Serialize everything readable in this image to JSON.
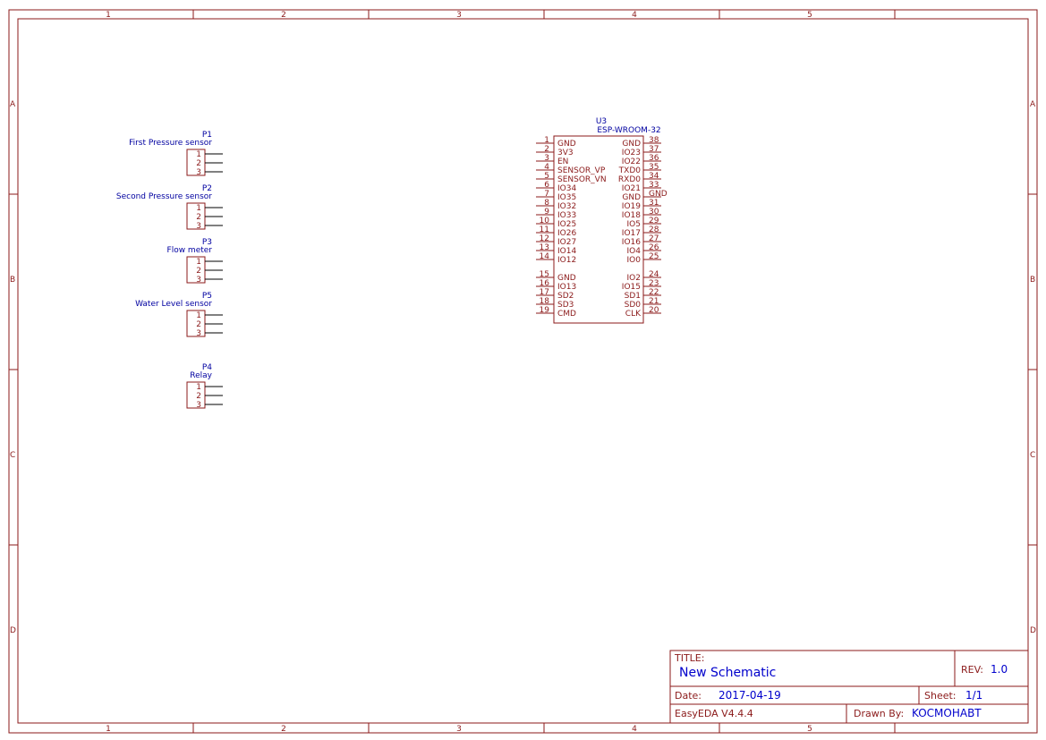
{
  "frame": {
    "columns": [
      "1",
      "2",
      "3",
      "4",
      "5"
    ],
    "rows": [
      "A",
      "B",
      "C",
      "D"
    ]
  },
  "connectors": [
    {
      "designator": "P1",
      "name": "First Pressure sensor",
      "pins": [
        "1",
        "2",
        "3"
      ]
    },
    {
      "designator": "P2",
      "name": "Second Pressure sensor",
      "pins": [
        "1",
        "2",
        "3"
      ]
    },
    {
      "designator": "P3",
      "name": "Flow meter",
      "pins": [
        "1",
        "2",
        "3"
      ]
    },
    {
      "designator": "P5",
      "name": "Water Level sensor",
      "pins": [
        "1",
        "2",
        "3"
      ]
    },
    {
      "designator": "P4",
      "name": "Relay",
      "pins": [
        "1",
        "2",
        "3"
      ]
    }
  ],
  "module": {
    "designator": "U3",
    "name": "ESP-WROOM-32",
    "left_pins": [
      {
        "num": "1",
        "label": "GND"
      },
      {
        "num": "2",
        "label": "3V3"
      },
      {
        "num": "3",
        "label": "EN"
      },
      {
        "num": "4",
        "label": "SENSOR_VP"
      },
      {
        "num": "5",
        "label": "SENSOR_VN"
      },
      {
        "num": "6",
        "label": "IO34"
      },
      {
        "num": "7",
        "label": "IO35"
      },
      {
        "num": "8",
        "label": "IO32"
      },
      {
        "num": "9",
        "label": "IO33"
      },
      {
        "num": "10",
        "label": "IO25"
      },
      {
        "num": "11",
        "label": "IO26"
      },
      {
        "num": "12",
        "label": "IO27"
      },
      {
        "num": "13",
        "label": "IO14"
      },
      {
        "num": "14",
        "label": "IO12"
      },
      {
        "num": "15",
        "label": "GND"
      },
      {
        "num": "16",
        "label": "IO13"
      },
      {
        "num": "17",
        "label": "SD2"
      },
      {
        "num": "18",
        "label": "SD3"
      },
      {
        "num": "19",
        "label": "CMD"
      }
    ],
    "right_pins": [
      {
        "num": "38",
        "label": "GND"
      },
      {
        "num": "37",
        "label": "IO23"
      },
      {
        "num": "36",
        "label": "IO22"
      },
      {
        "num": "35",
        "label": "TXD0"
      },
      {
        "num": "34",
        "label": "RXD0"
      },
      {
        "num": "33",
        "label": "IO21"
      },
      {
        "num": "GND",
        "label": ""
      },
      {
        "num": "31",
        "label": "IO19"
      },
      {
        "num": "30",
        "label": "IO18"
      },
      {
        "num": "29",
        "label": "IO5"
      },
      {
        "num": "28",
        "label": "IO17"
      },
      {
        "num": "27",
        "label": "IO16"
      },
      {
        "num": "26",
        "label": "IO4"
      },
      {
        "num": "25",
        "label": "IO0"
      },
      {
        "num": "24",
        "label": "IO2"
      },
      {
        "num": "23",
        "label": "IO15"
      },
      {
        "num": "22",
        "label": "SD1"
      },
      {
        "num": "21",
        "label": "SD0"
      },
      {
        "num": "20",
        "label": "CLK"
      }
    ],
    "extra_right_label": "GND"
  },
  "title_block": {
    "title_label": "TITLE:",
    "title_value": "New Schematic",
    "rev_label": "REV:",
    "rev_value": "1.0",
    "date_label": "Date:",
    "date_value": "2017-04-19",
    "sheet_label": "Sheet:",
    "sheet_value": "1/1",
    "software": "EasyEDA V4.4.4",
    "drawn_by_label": "Drawn By:",
    "drawn_by_value": "KOCMOHABT"
  }
}
